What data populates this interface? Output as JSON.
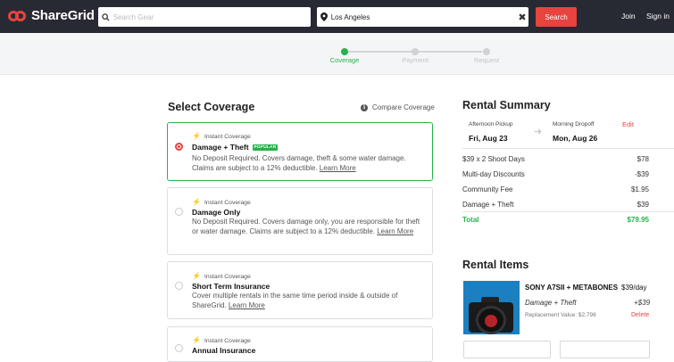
{
  "header": {
    "brand": "ShareGrid",
    "search_placeholder": "Search Gear",
    "location_value": "Los Angeles",
    "search_button": "Search",
    "join": "Join",
    "sign_in": "Sign in"
  },
  "steps": [
    {
      "label": "Coverage",
      "active": true
    },
    {
      "label": "Payment",
      "active": false
    },
    {
      "label": "Request",
      "active": false
    }
  ],
  "coverage": {
    "title": "Select Coverage",
    "compare_link": "Compare Coverage",
    "options": [
      {
        "tag": "Instant Coverage",
        "name": "Damage + Theft",
        "badge": "POPULAR",
        "desc": "No Deposit Required. Covers damage, theft & some water damage. Claims are subject to a 12% deductible.",
        "link": "Learn More",
        "selected": true
      },
      {
        "tag": "Instant Coverage",
        "name": "Damage Only",
        "badge": "",
        "desc": "No Deposit Required. Covers damage only, you are responsible for theft or water damage. Claims are subject to a 12% deductible.",
        "link": "Learn More",
        "selected": false
      },
      {
        "tag": "Instant Coverage",
        "name": "Short Term Insurance",
        "badge": "",
        "desc": "Cover multiple rentals in the same time period inside & outside of ShareGrid.",
        "link": "Learn More",
        "selected": false
      },
      {
        "tag": "Instant Coverage",
        "name": "Annual Insurance",
        "badge": "",
        "desc": "",
        "link": "",
        "selected": false
      }
    ]
  },
  "summary": {
    "title": "Rental Summary",
    "pickup_label": "Afternoon Pickup",
    "pickup_date": "Fri, Aug 23",
    "dropoff_label": "Morning Dropoff",
    "dropoff_date": "Mon, Aug 26",
    "edit": "Edit",
    "lines": [
      {
        "label": "$39 x 2 Shoot Days",
        "value": "$78"
      },
      {
        "label": "Multi-day Discounts",
        "value": "-$39"
      },
      {
        "label": "Community Fee",
        "value": "$1.95"
      },
      {
        "label": "Damage + Theft",
        "value": "$39"
      }
    ],
    "total_label": "Total",
    "total_value": "$79.95"
  },
  "items": {
    "title": "Rental Items",
    "name": "SONY A7SII + METABONES",
    "price": "$39/day",
    "coverage": "Damage + Theft",
    "coverage_price": "+$39",
    "replacement": "Replacement Value: $2,798",
    "delete": "Delete"
  },
  "colors": {
    "accent": "#e8433e",
    "success": "#27b24a",
    "header_bg": "#272a33"
  }
}
